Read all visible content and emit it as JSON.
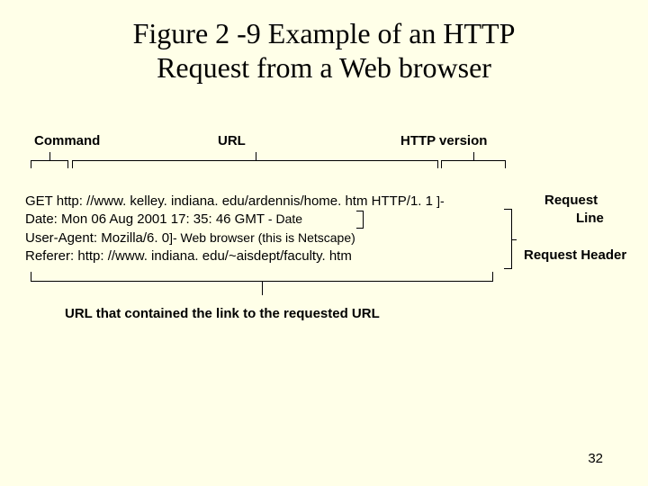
{
  "title_line1": "Figure 2 -9 Example of an HTTP",
  "title_line2": "Request from a Web browser",
  "labels": {
    "command": "Command",
    "url": "URL",
    "version": "HTTP version",
    "request_line1": "Request",
    "request_line2": "Line",
    "request_header": "Request Header",
    "bottom": "URL that contained the link to the requested URL"
  },
  "request": {
    "line1_prefix": "GET http: //www. kelley. indiana. edu/ardennis/home. htm HTTP/1. 1",
    "line1_suffix": "]-",
    "line2_text": "Date: Mon 06 Aug 2001 17: 35: 46 GMT",
    "line2_annot": "- Date",
    "line3_text": "User-Agent: Mozilla/6. 0",
    "line3_annot": "]- Web browser (this is Netscape)",
    "line4_text": "Referer: http: //www. indiana. edu/~aisdept/faculty. htm"
  },
  "page_number": "32"
}
